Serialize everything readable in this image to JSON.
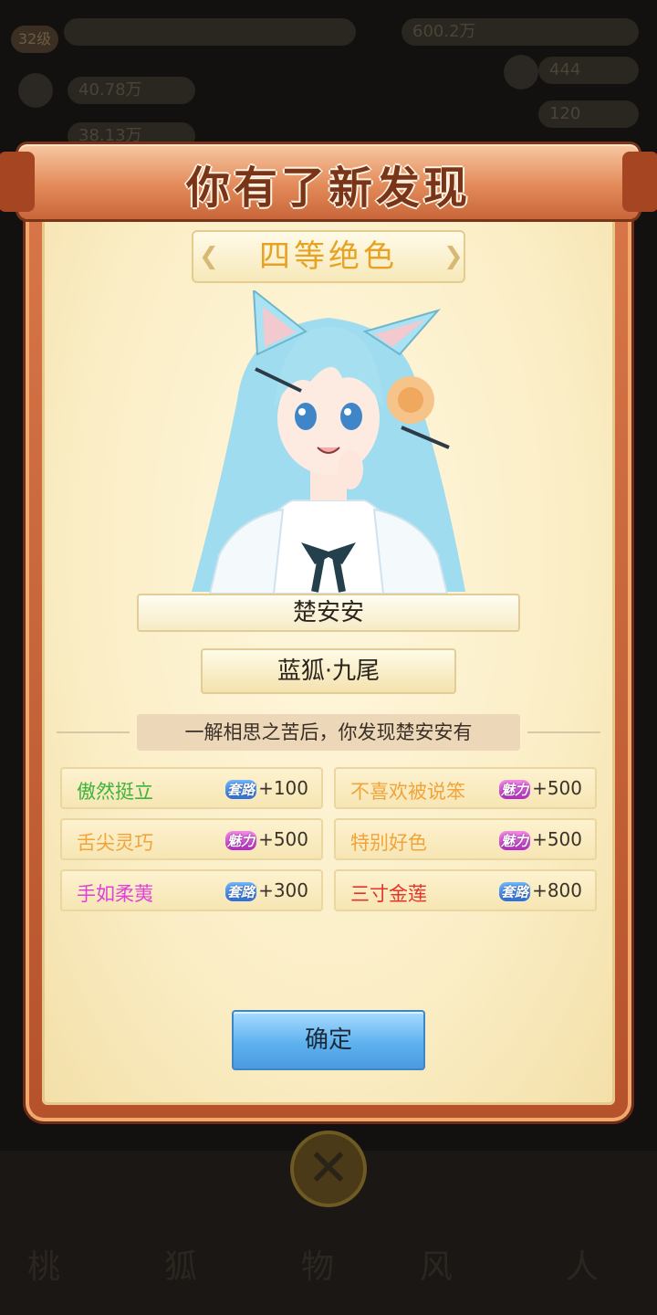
{
  "background": {
    "level": "32级",
    "stats_top": "600.2万",
    "stat_left_1": "40.78万",
    "stat_left_2": "38.13万",
    "stat_right_1": "444",
    "stat_right_2": "120"
  },
  "modal": {
    "title": "你有了新发现",
    "grade": "四等绝色",
    "character_name": "楚安安",
    "character_title": "蓝狐·九尾",
    "description": "一解相思之苦后，你发现楚安安有",
    "traits": [
      {
        "name": "傲然挺立",
        "name_color": "#3db53b",
        "stat_label": "套路",
        "stat_type": "blue",
        "value": "+100"
      },
      {
        "name": "不喜欢被说笨",
        "name_color": "#f0a43a",
        "stat_label": "魅力",
        "stat_type": "pink",
        "value": "+500"
      },
      {
        "name": "舌尖灵巧",
        "name_color": "#f0a43a",
        "stat_label": "魅力",
        "stat_type": "pink",
        "value": "+500"
      },
      {
        "name": "特别好色",
        "name_color": "#f0a43a",
        "stat_label": "魅力",
        "stat_type": "pink",
        "value": "+500"
      },
      {
        "name": "手如柔荑",
        "name_color": "#e040d8",
        "stat_label": "套路",
        "stat_type": "blue",
        "value": "+300"
      },
      {
        "name": "三寸金莲",
        "name_color": "#e3342a",
        "stat_label": "套路",
        "stat_type": "blue",
        "value": "+800"
      }
    ],
    "confirm_label": "确定"
  },
  "colors": {
    "grade": "#e8a223",
    "button": "#5fb2ef",
    "frame": "#d9784a"
  }
}
